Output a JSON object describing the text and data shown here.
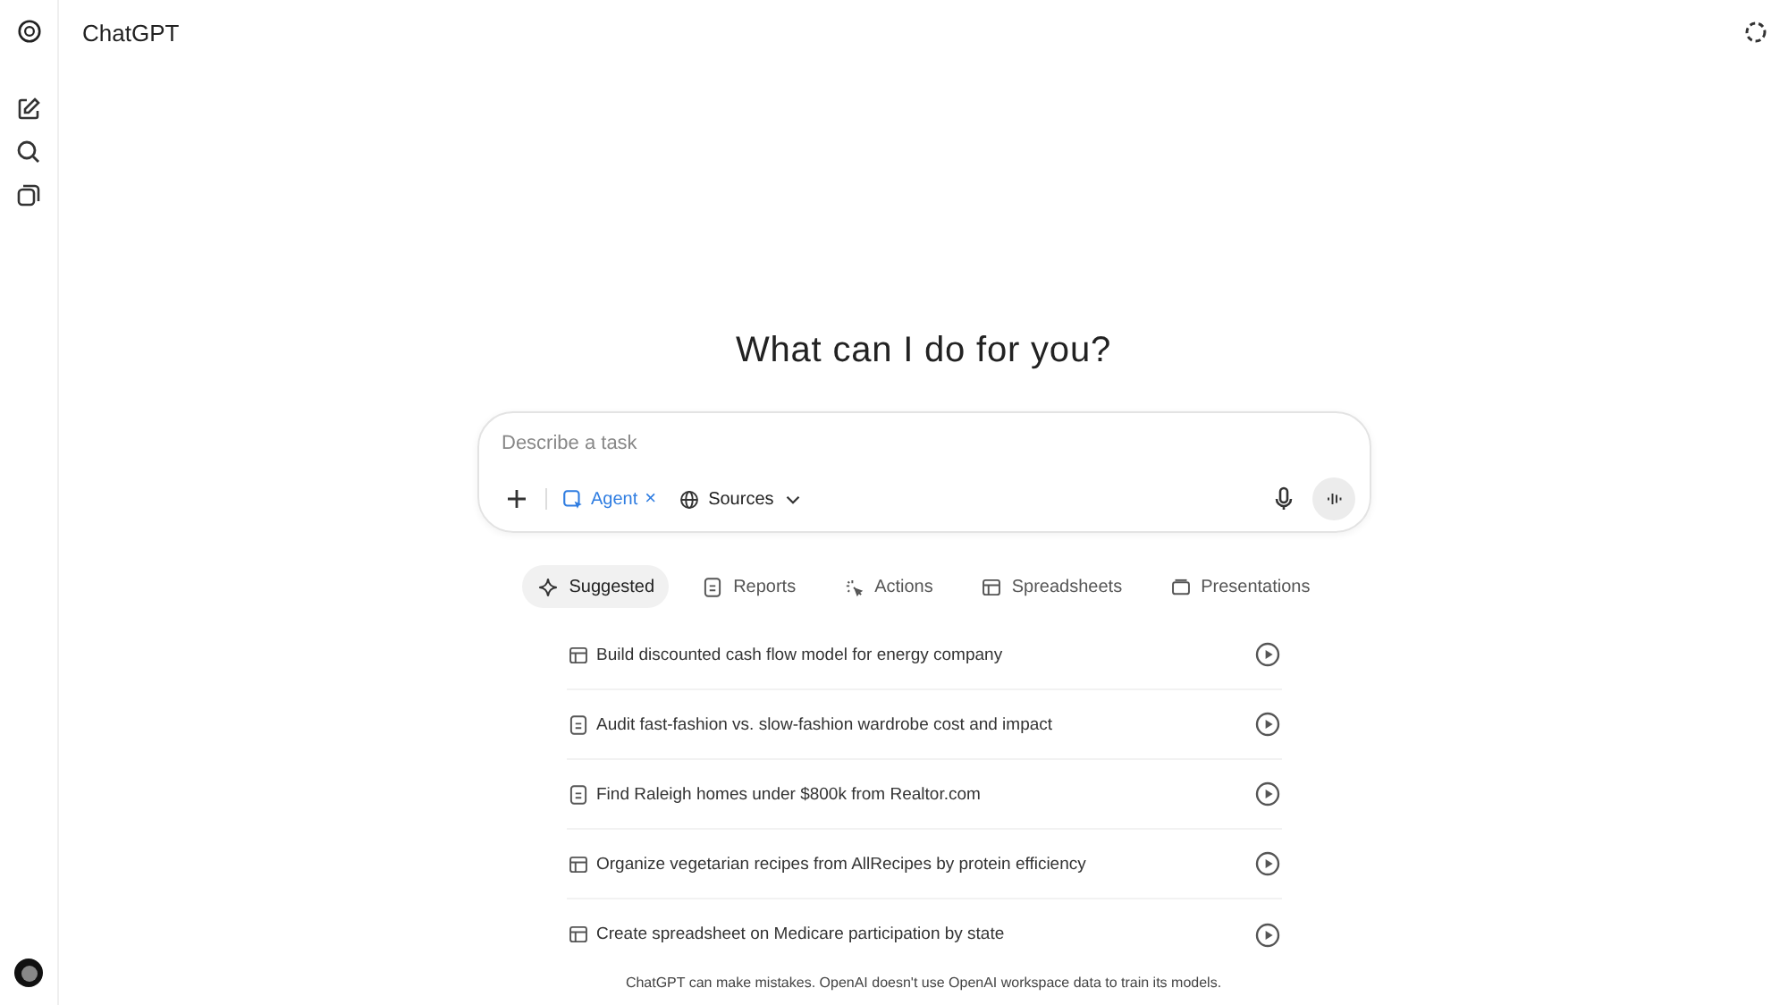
{
  "header": {
    "title": "ChatGPT"
  },
  "heading": "What can I do for you?",
  "composer": {
    "placeholder": "Describe a task",
    "agent_chip": {
      "label": "Agent",
      "close": "×"
    },
    "sources": {
      "label": "Sources"
    }
  },
  "tabs": [
    {
      "label": "Suggested",
      "kind": "sparkle",
      "selected": true
    },
    {
      "label": "Reports",
      "kind": "report",
      "selected": false
    },
    {
      "label": "Actions",
      "kind": "actions",
      "selected": false
    },
    {
      "label": "Spreadsheets",
      "kind": "spreadsheet",
      "selected": false
    },
    {
      "label": "Presentations",
      "kind": "presentation",
      "selected": false
    }
  ],
  "tasks": [
    {
      "label": "Build discounted cash flow model for energy company",
      "kind": "spreadsheet"
    },
    {
      "label": "Audit fast-fashion vs. slow-fashion wardrobe cost and impact",
      "kind": "report"
    },
    {
      "label": "Find Raleigh homes under $800k from Realtor.com",
      "kind": "report"
    },
    {
      "label": "Organize vegetarian recipes from AllRecipes by protein efficiency",
      "kind": "spreadsheet"
    },
    {
      "label": "Create spreadsheet on Medicare participation by state",
      "kind": "spreadsheet"
    }
  ],
  "footer": "ChatGPT can make mistakes. OpenAI doesn't use OpenAI workspace data to train its models."
}
